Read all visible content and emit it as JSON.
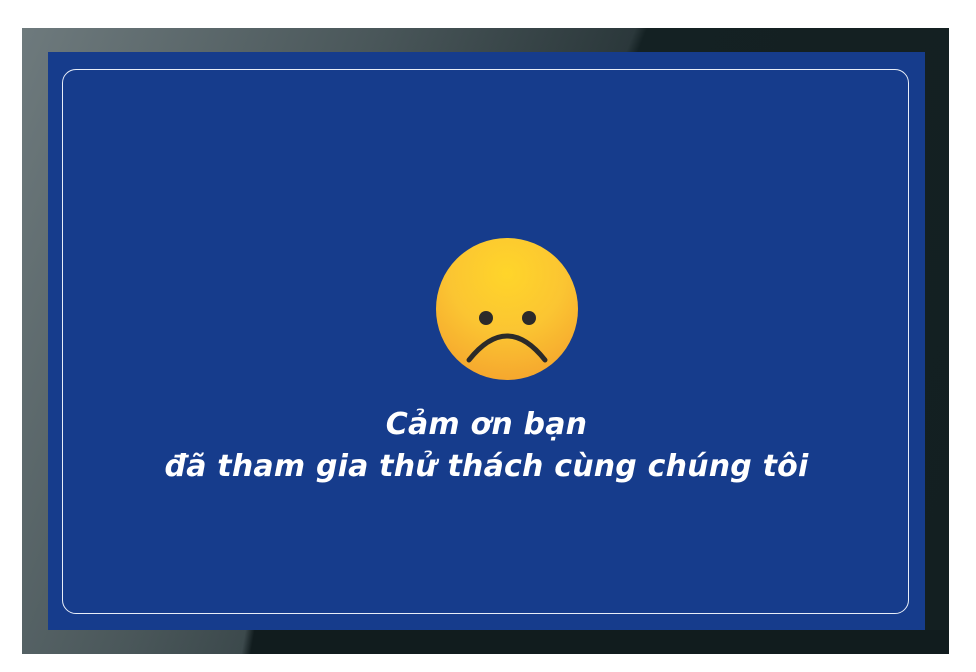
{
  "message": {
    "line1": "Cảm ơn bạn",
    "line2": "đã tham gia thử thách cùng chúng tôi"
  },
  "icons": {
    "face": "sad-face-icon"
  },
  "colors": {
    "panel_background": "#163c8c",
    "text": "#ffffff",
    "face_top": "#ffd52a",
    "face_bottom": "#f19a2a"
  }
}
